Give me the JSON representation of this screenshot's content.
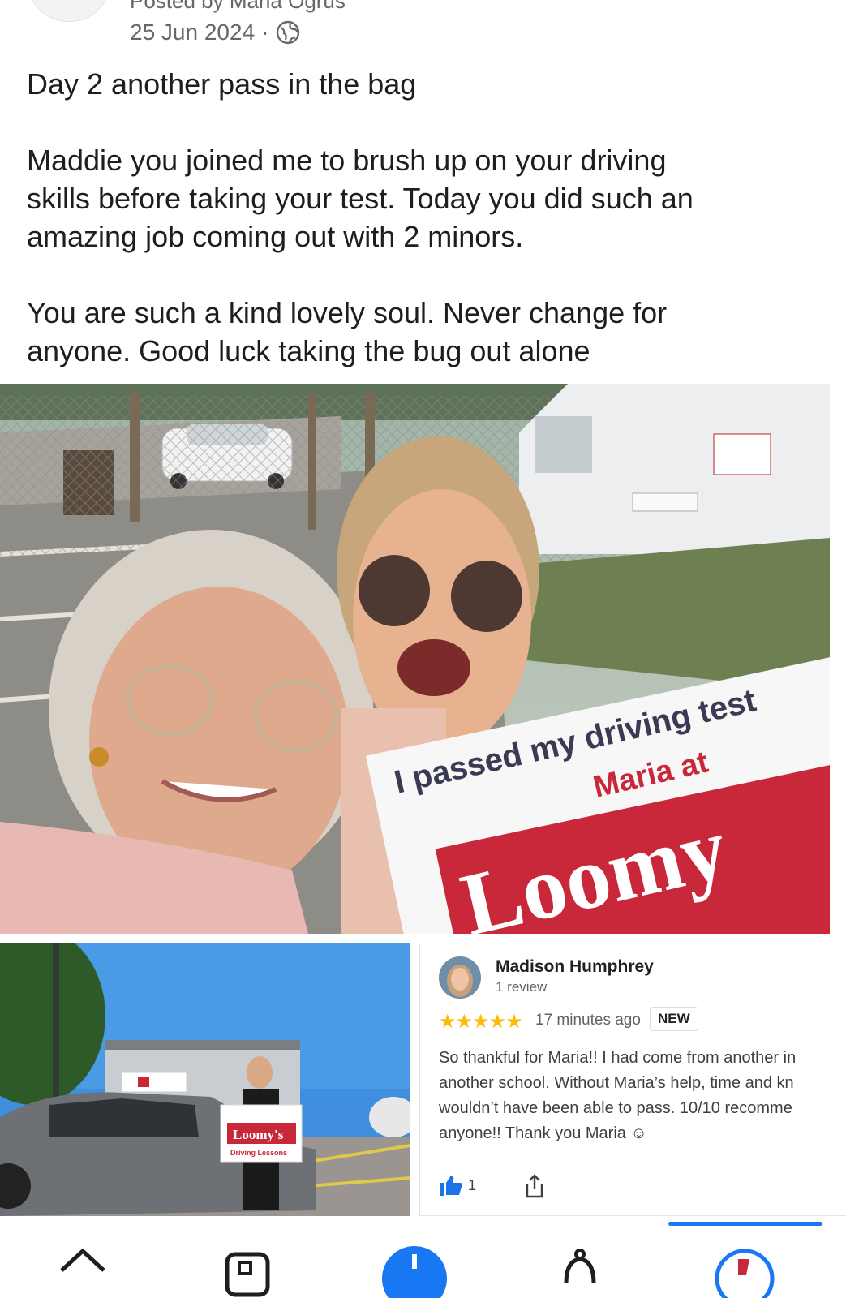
{
  "header": {
    "posted_by": "Posted by Maria Ogrus",
    "date": "25 Jun 2024",
    "separator": "·",
    "privacy_icon": "globe-icon"
  },
  "post": {
    "paragraph_1": "Day 2 another pass in the bag",
    "paragraph_2_line_1": "Maddie you joined me to brush up on your driving",
    "paragraph_2_line_2": "skills before taking your test. Today you did such an",
    "paragraph_2_line_3": "amazing job coming out with 2 minors.",
    "paragraph_3_line_1": "You are such a kind lovely soul. Never change for",
    "paragraph_3_line_2": "anyone. Good luck taking the bug out alone"
  },
  "photo_main": {
    "sign_line_1": "I passed my driving test",
    "sign_line_2": "Maria at",
    "sign_brand": "Loomy"
  },
  "photo_small": {
    "sign_brand": "Loomy's",
    "sign_sub": "Driving Lessons"
  },
  "review": {
    "name": "Madison Humphrey",
    "review_count": "1 review",
    "stars": "★★★★★",
    "time": "17 minutes ago",
    "badge": "NEW",
    "text_line_1": "So thankful for Maria!! I had come from another in",
    "text_line_2": "another school. Without Maria’s help, time and kn",
    "text_line_3": "wouldn’t have been able to pass. 10/10 recomme",
    "text_line_4": "anyone!! Thank you Maria ☺",
    "like_count": "1"
  },
  "colors": {
    "brand_blue": "#1877f2",
    "star_yellow": "#fbbc04",
    "loomy_red": "#c8283a"
  },
  "nav": {
    "icons": [
      "home-icon",
      "video-icon",
      "create-icon",
      "notifications-icon",
      "profile-icon"
    ]
  }
}
